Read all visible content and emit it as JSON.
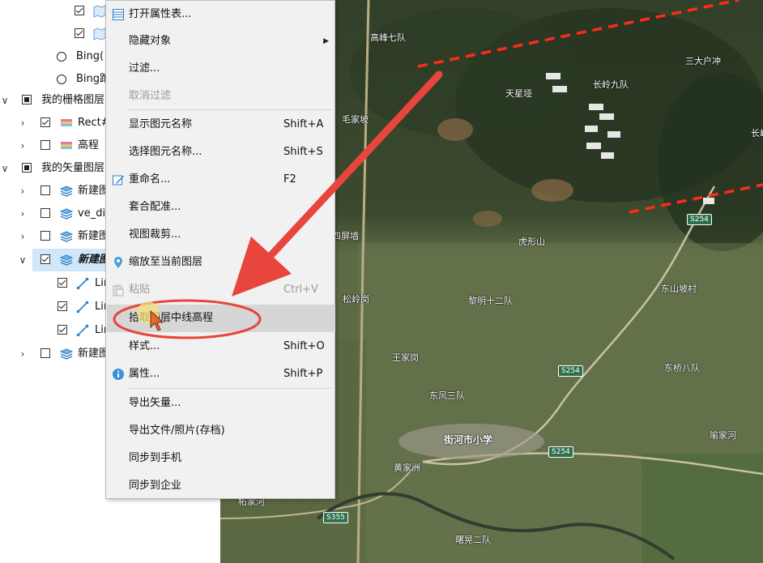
{
  "tree": {
    "rows": [
      {
        "label": "",
        "type": "data"
      },
      {
        "label": "",
        "type": "data"
      },
      {
        "label": "Bing(",
        "type": "radio"
      },
      {
        "label": "Bing跑",
        "type": "radio"
      },
      {
        "label": "我的栅格图层",
        "type": "group"
      },
      {
        "label": "Rect#",
        "type": "raster"
      },
      {
        "label": "高程",
        "type": "raster"
      },
      {
        "label": "我的矢量图层",
        "type": "group"
      },
      {
        "label": "新建图",
        "type": "vector"
      },
      {
        "label": "ve_di",
        "type": "vector"
      },
      {
        "label": "新建图",
        "type": "vector"
      },
      {
        "label": "新建图",
        "type": "vector",
        "selected": true
      },
      {
        "label": "Lin",
        "type": "line"
      },
      {
        "label": "Lin",
        "type": "line"
      },
      {
        "label": "Lin",
        "type": "line"
      },
      {
        "label": "新建图",
        "type": "vector"
      }
    ]
  },
  "menu": {
    "items": [
      {
        "label": "打开属性表...",
        "shortcut": "",
        "icon": "table-icon"
      },
      {
        "label": "隐藏对象",
        "shortcut": "",
        "submenu": true
      },
      {
        "label": "过滤...",
        "shortcut": ""
      },
      {
        "label": "取消过滤",
        "shortcut": "",
        "disabled": true
      },
      {
        "label": "显示图元名称",
        "shortcut": "Shift+A"
      },
      {
        "label": "选择图元名称...",
        "shortcut": "Shift+S"
      },
      {
        "label": "重命名...",
        "shortcut": "F2",
        "icon": "rename-icon"
      },
      {
        "label": "套合配准...",
        "shortcut": ""
      },
      {
        "label": "视图裁剪...",
        "shortcut": ""
      },
      {
        "label": "缩放至当前图层",
        "shortcut": "",
        "icon": "zoom-layer-icon"
      },
      {
        "label": "粘贴",
        "shortcut": "Ctrl+V",
        "disabled": true,
        "icon": "paste-icon"
      },
      {
        "label": "拾取图层中线高程",
        "shortcut": "",
        "highlighted": true
      },
      {
        "label": "样式...",
        "shortcut": "Shift+O"
      },
      {
        "label": "属性...",
        "shortcut": "Shift+P",
        "icon": "info-icon"
      },
      {
        "label": "导出矢量...",
        "shortcut": ""
      },
      {
        "label": "导出文件/照片(存档)",
        "shortcut": ""
      },
      {
        "label": "同步到手机",
        "shortcut": ""
      },
      {
        "label": "同步到企业",
        "shortcut": ""
      }
    ]
  },
  "map": {
    "places": [
      "高峰七队",
      "三大户冲",
      "天星垭",
      "长岭九队",
      "毛家坡",
      "长岭",
      "四屏墙",
      "虎形山",
      "S254",
      "松岭岗",
      "黎明十二队",
      "东山坡村",
      "王家岗",
      "S254",
      "东桥八队",
      "东风三队",
      "街河市小学",
      "黄家洲",
      "S254",
      "喻家河",
      "柘家河",
      "S355",
      "曙晃二队"
    ]
  },
  "colors": {
    "menu_bg": "#f1f1f1",
    "selection": "#cfe6fb",
    "annotation_red": "#e8453c",
    "dashed_line": "#ff2a1a"
  }
}
